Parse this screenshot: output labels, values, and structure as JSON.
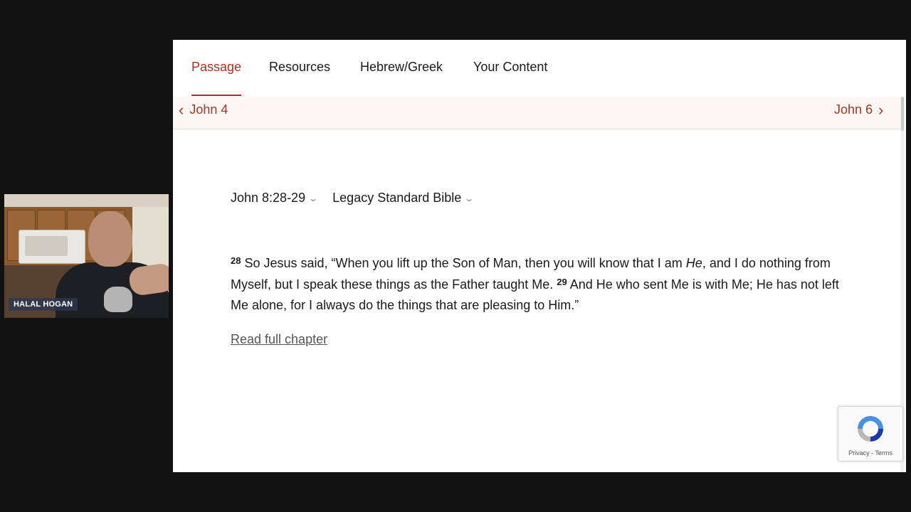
{
  "webcam": {
    "name_label": "HALAL HOGAN"
  },
  "tabs": [
    {
      "label": "Passage",
      "active": true
    },
    {
      "label": "Resources",
      "active": false
    },
    {
      "label": "Hebrew/Greek",
      "active": false
    },
    {
      "label": "Your Content",
      "active": false
    }
  ],
  "chapter_nav": {
    "prev_label": "John 4",
    "next_label": "John 6"
  },
  "selectors": {
    "reference": "John 8:28-29",
    "version": "Legacy Standard Bible"
  },
  "passage": {
    "v28_num": "28",
    "v28_text_a": " So Jesus said, “When you lift up the Son of Man, then you will know that I am ",
    "v28_italic": "He",
    "v28_text_b": ", and I do nothing from Myself, but I speak these things as the Father taught Me. ",
    "v29_num": "29",
    "v29_text": " And He who sent Me is with Me; He has not left Me alone, for I always do the things that are pleasing to Him.”"
  },
  "read_full_chapter": "Read full chapter",
  "recaptcha": {
    "terms": "Privacy - Terms"
  },
  "colors": {
    "accent": "#a8341f",
    "background": "#111111",
    "panel": "#ffffff"
  }
}
